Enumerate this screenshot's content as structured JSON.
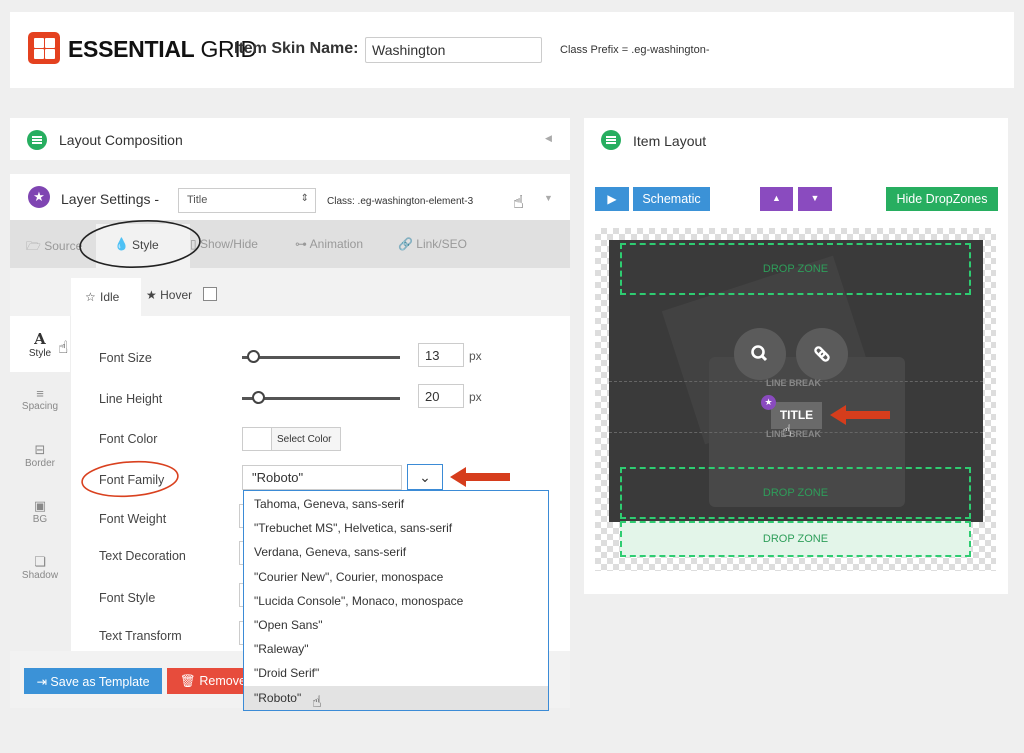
{
  "header": {
    "logo_bold": "ESSENTIAL",
    "logo_light": "GRID",
    "skin_name_label": "Item Skin Name:",
    "skin_name_value": "Washington",
    "class_prefix": "Class Prefix = .eg-washington-"
  },
  "layout_composition": {
    "title": "Layout Composition"
  },
  "layer_settings": {
    "title": "Layer Settings -",
    "layer_select": "Title",
    "class_text": "Class: .eg-washington-element-3"
  },
  "tabs": [
    "Source",
    "Style",
    "Show/Hide",
    "Animation",
    "Link/SEO"
  ],
  "state_tabs": {
    "idle": "Idle",
    "hover": "Hover"
  },
  "sidebar": [
    "Style",
    "Spacing",
    "Border",
    "BG",
    "Shadow"
  ],
  "fields": {
    "font_size": {
      "label": "Font Size",
      "value": "13",
      "unit": "px"
    },
    "line_height": {
      "label": "Line Height",
      "value": "20",
      "unit": "px"
    },
    "font_color": {
      "label": "Font Color",
      "button": "Select Color"
    },
    "font_family": {
      "label": "Font Family",
      "value": "\"Roboto\""
    },
    "font_weight": {
      "label": "Font Weight"
    },
    "text_decoration": {
      "label": "Text Decoration"
    },
    "font_style": {
      "label": "Font Style"
    },
    "text_transform": {
      "label": "Text Transform"
    }
  },
  "font_options": [
    "Tahoma, Geneva, sans-serif",
    "\"Trebuchet MS\", Helvetica, sans-serif",
    "Verdana, Geneva, sans-serif",
    "\"Courier New\", Courier, monospace",
    "\"Lucida Console\", Monaco, monospace",
    "\"Open Sans\"",
    "\"Raleway\"",
    "\"Droid Serif\"",
    "\"Roboto\""
  ],
  "footer_buttons": {
    "save_template": "Save as Template",
    "remove": "Remove"
  },
  "item_layout": {
    "title": "Item Layout",
    "schematic": "Schematic",
    "hide_dropzones": "Hide DropZones",
    "drop_zone": "DROP ZONE",
    "line_break": "LINE BREAK",
    "title_element": "TITLE"
  },
  "colors": {
    "accent_red": "#e4411f",
    "green": "#27ae60",
    "purple": "#8a4bbf",
    "blue": "#3b92d7"
  }
}
